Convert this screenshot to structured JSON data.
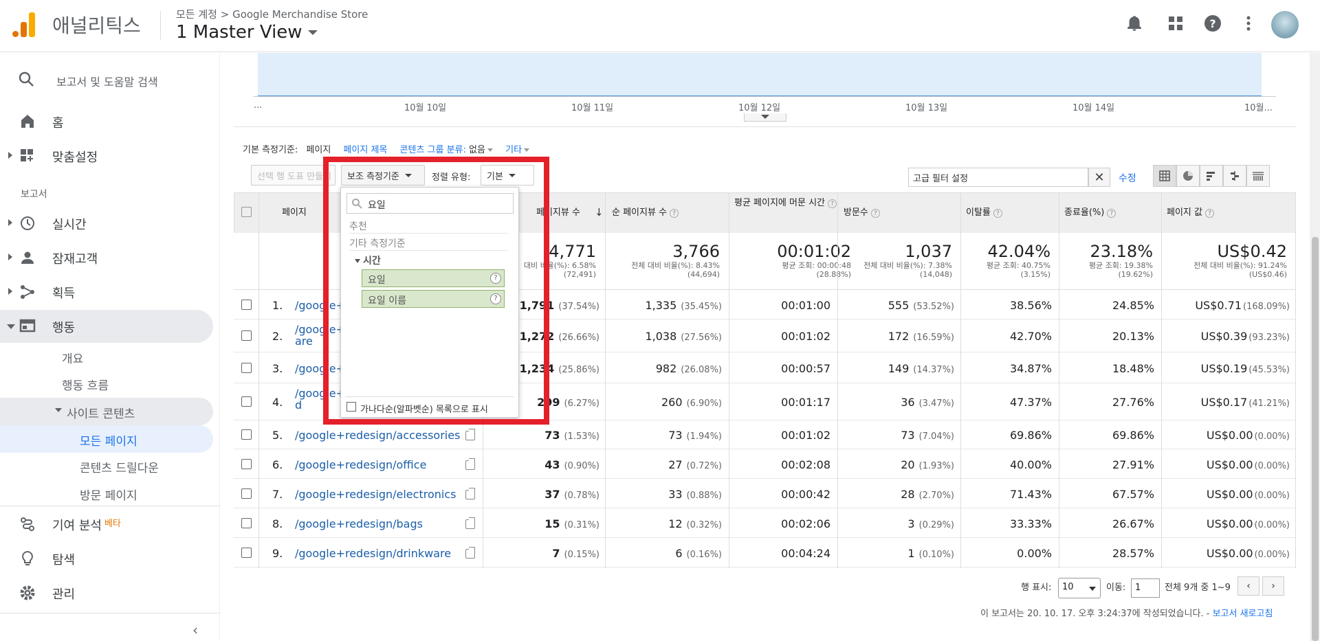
{
  "header": {
    "app_name": "애널리틱스",
    "breadcrumb": "모든 계정 > Google Merchandise Store",
    "view_name": "1 Master View",
    "icons": [
      "bell-icon",
      "apps-icon",
      "help-icon",
      "more-vert-icon"
    ]
  },
  "sidebar": {
    "search_placeholder": "보고서 및 도움말 검색",
    "home": "홈",
    "customization": "맞춤설정",
    "section_reports": "보고서",
    "realtime": "실시간",
    "audience": "잠재고객",
    "acquisition": "획득",
    "behavior": "행동",
    "behavior_overview": "개요",
    "behavior_flow": "행동 흐름",
    "site_content": "사이트 콘텐츠",
    "all_pages": "모든 페이지",
    "content_drilldown": "콘텐츠 드릴다운",
    "landing_pages": "방문 페이지",
    "attribution": "기여 분석",
    "beta": "베타",
    "discover": "탐색",
    "admin": "관리",
    "collapse": "‹"
  },
  "chart": {
    "xticks": [
      "...",
      "10월 10일",
      "10월 11일",
      "10월 12일",
      "10월 13일",
      "10월 14일",
      "10월..."
    ]
  },
  "dimensions": {
    "label": "기본 측정기준:",
    "current": "페이지",
    "page_title": "페이지 제목",
    "content_group": "콘텐츠 그룹 분류:",
    "content_group_value": "없음",
    "other": "기타"
  },
  "toolbar": {
    "plot_rows": "선택 행 도표 만들기",
    "secondary_dim": "보조 측정기준",
    "sort_label": "정렬 유형:",
    "sort_value": "기본",
    "filter_value": "고급 필터 설정",
    "modify": "수정"
  },
  "table": {
    "headers": {
      "page": "페이지",
      "pageviews": "페이지뷰 수",
      "unique_pageviews": "순 페이지뷰 수",
      "avg_time": "평균 페이지에 머문 시간",
      "entrances": "방문수",
      "bounce": "이탈률",
      "exit": "종료율(%)",
      "value": "페이지 값"
    },
    "totals": {
      "pageviews": "4,771",
      "pageviews_sub1": "대비 비율(%): 6.58%",
      "pageviews_sub2": "(72,491)",
      "unique": "3,766",
      "unique_sub1": "전체 대비 비율(%): 8.43%",
      "unique_sub2": "(44,694)",
      "avg_time": "00:01:02",
      "avg_time_sub1": "평균 조회: 00:00:48",
      "avg_time_sub2": "(28.88%)",
      "entrances": "1,037",
      "entrances_sub1": "전체 대비 비율(%): 7.38%",
      "entrances_sub2": "(14,048)",
      "bounce": "42.04%",
      "bounce_sub1": "평균 조회: 40.75%",
      "bounce_sub2": "(3.15%)",
      "exit": "23.18%",
      "exit_sub1": "평균 조회: 19.38%",
      "exit_sub2": "(19.62%)",
      "value": "US$0.42",
      "value_sub1": "전체 대비 비율(%): 91.24%",
      "value_sub2": "(US$0.46)"
    },
    "rows": [
      {
        "idx": "1.",
        "page": "/google+",
        "pv": "1,791",
        "pvp": "(37.54%)",
        "upv": "1,335",
        "upvp": "(35.45%)",
        "time": "00:01:00",
        "ent": "555",
        "entp": "(53.52%)",
        "bounce": "38.56%",
        "exit": "24.85%",
        "val": "US$0.71",
        "valp": "(168.09%)"
      },
      {
        "idx": "2.",
        "page": "/google+",
        "page2": "are",
        "pv": "1,272",
        "pvp": "(26.66%)",
        "upv": "1,038",
        "upvp": "(27.56%)",
        "time": "00:01:02",
        "ent": "172",
        "entp": "(16.59%)",
        "bounce": "42.70%",
        "exit": "20.13%",
        "val": "US$0.39",
        "valp": "(93.23%)"
      },
      {
        "idx": "3.",
        "page": "/google+",
        "pv": "1,234",
        "pvp": "(25.86%)",
        "upv": "982",
        "upvp": "(26.08%)",
        "time": "00:00:57",
        "ent": "149",
        "entp": "(14.37%)",
        "bounce": "34.87%",
        "exit": "18.48%",
        "val": "US$0.19",
        "valp": "(45.53%)"
      },
      {
        "idx": "4.",
        "page": "/google+",
        "page2": "d",
        "pv": "299",
        "pvp": "(6.27%)",
        "upv": "260",
        "upvp": "(6.90%)",
        "time": "00:01:17",
        "ent": "36",
        "entp": "(3.47%)",
        "bounce": "47.37%",
        "exit": "27.76%",
        "val": "US$0.17",
        "valp": "(41.21%)"
      },
      {
        "idx": "5.",
        "page": "/google+redesign/accessories",
        "pv": "73",
        "pvp": "(1.53%)",
        "upv": "73",
        "upvp": "(1.94%)",
        "time": "00:01:02",
        "ent": "73",
        "entp": "(7.04%)",
        "bounce": "69.86%",
        "exit": "69.86%",
        "val": "US$0.00",
        "valp": "(0.00%)"
      },
      {
        "idx": "6.",
        "page": "/google+redesign/office",
        "pv": "43",
        "pvp": "(0.90%)",
        "upv": "27",
        "upvp": "(0.72%)",
        "time": "00:02:08",
        "ent": "20",
        "entp": "(1.93%)",
        "bounce": "40.00%",
        "exit": "27.91%",
        "val": "US$0.00",
        "valp": "(0.00%)"
      },
      {
        "idx": "7.",
        "page": "/google+redesign/electronics",
        "pv": "37",
        "pvp": "(0.78%)",
        "upv": "33",
        "upvp": "(0.88%)",
        "time": "00:00:42",
        "ent": "28",
        "entp": "(2.70%)",
        "bounce": "71.43%",
        "exit": "67.57%",
        "val": "US$0.00",
        "valp": "(0.00%)"
      },
      {
        "idx": "8.",
        "page": "/google+redesign/bags",
        "pv": "15",
        "pvp": "(0.31%)",
        "upv": "12",
        "upvp": "(0.32%)",
        "time": "00:02:06",
        "ent": "3",
        "entp": "(0.29%)",
        "bounce": "33.33%",
        "exit": "26.67%",
        "val": "US$0.00",
        "valp": "(0.00%)"
      },
      {
        "idx": "9.",
        "page": "/google+redesign/drinkware",
        "pv": "7",
        "pvp": "(0.15%)",
        "upv": "6",
        "upvp": "(0.16%)",
        "time": "00:04:24",
        "ent": "1",
        "entp": "(0.10%)",
        "bounce": "0.00%",
        "exit": "28.57%",
        "val": "US$0.00",
        "valp": "(0.00%)"
      }
    ]
  },
  "pagination": {
    "show_rows_label": "행 표시:",
    "show_rows_value": "10",
    "goto_label": "이동:",
    "goto_value": "1",
    "range": "전체 9개 중 1~9",
    "prev": "‹",
    "next": "›"
  },
  "report_note": {
    "text": "이 보고서는 20. 10. 17. 오후 3:24:37에 작성되었습니다. -",
    "refresh": "보고서 새로고침"
  },
  "dropdown": {
    "search_value": "요일",
    "recommended": "추천",
    "other_dims": "기타 측정기준",
    "time_group": "시간",
    "items": [
      "요일",
      "요일 이름"
    ],
    "help_mark": "?",
    "alpha_label": "가나다순(알파벳순) 목록으로 표시"
  },
  "colors": {
    "highlight_box": "#e4202a",
    "accent": "#1a73e8",
    "logo": "#f9ab00"
  }
}
